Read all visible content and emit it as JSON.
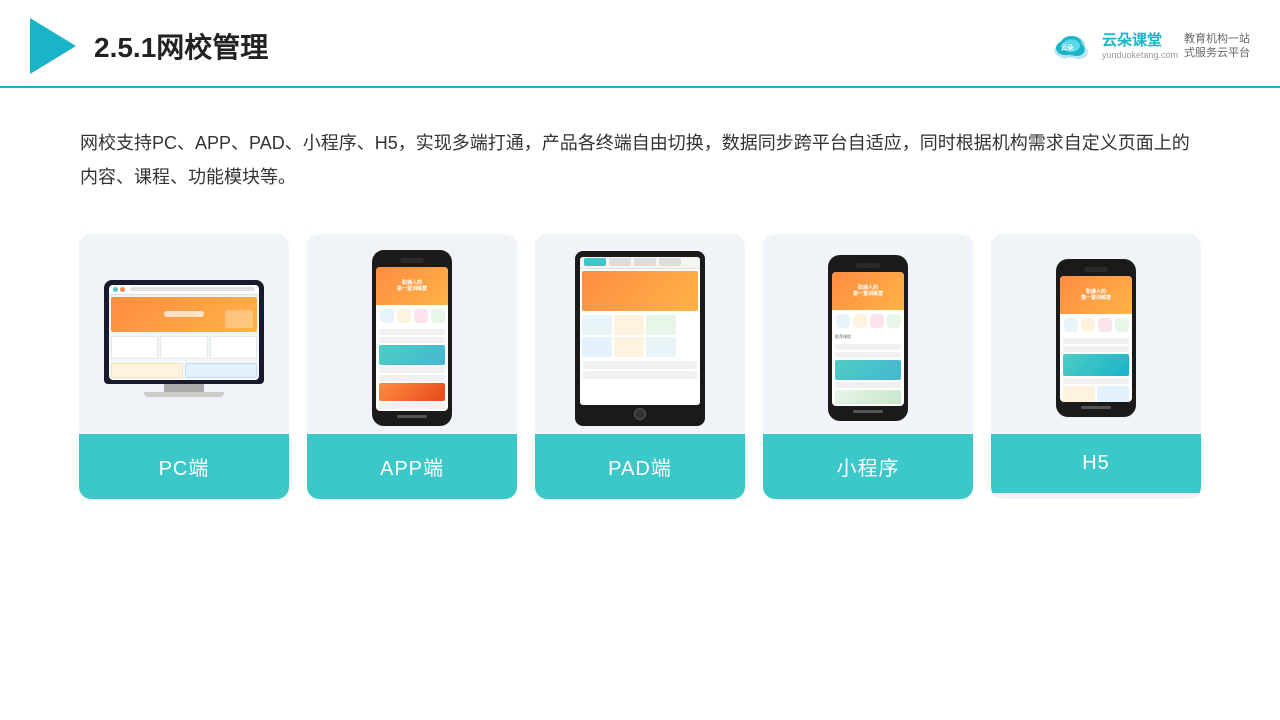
{
  "header": {
    "title": "2.5.1网校管理",
    "brand": {
      "name": "云朵课堂",
      "url": "yunduoketang.com",
      "slogan": "教育机构一站\n式服务云平台"
    }
  },
  "description": {
    "text": "网校支持PC、APP、PAD、小程序、H5，实现多端打通，产品各终端自由切换，数据同步跨平台自适应，同时根据机构需求自定义页面上的内容、课程、功能模块等。"
  },
  "cards": [
    {
      "id": "pc",
      "label": "PC端",
      "type": "pc"
    },
    {
      "id": "app",
      "label": "APP端",
      "type": "phone"
    },
    {
      "id": "pad",
      "label": "PAD端",
      "type": "tablet"
    },
    {
      "id": "miniprogram",
      "label": "小程序",
      "type": "phone"
    },
    {
      "id": "h5",
      "label": "H5",
      "type": "phone"
    }
  ],
  "colors": {
    "teal": "#3cc8c8",
    "accent": "#1ab3c8",
    "dark": "#1a1a1a"
  }
}
